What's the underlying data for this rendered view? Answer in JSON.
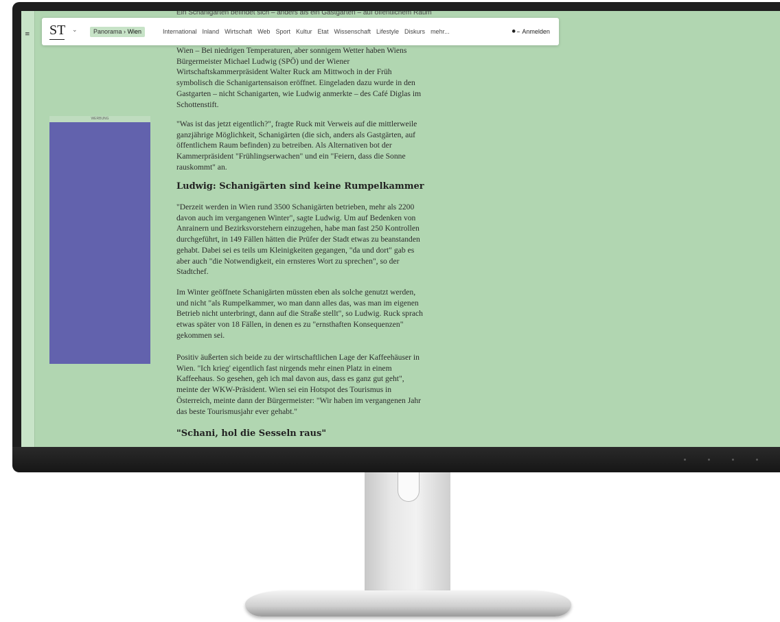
{
  "site": {
    "logo": "ST",
    "breadcrumb_section": "Panorama",
    "breadcrumb_sep": "›",
    "breadcrumb_current": "Wien",
    "nav_items": [
      "International",
      "Inland",
      "Wirtschaft",
      "Web",
      "Sport",
      "Kultur",
      "Etat",
      "Wissenschaft",
      "Lifestyle",
      "Diskurs",
      "mehr..."
    ],
    "login_label": "Anmelden"
  },
  "ad": {
    "label": "WERBUNG"
  },
  "article": {
    "teaser_cut": "Ein Schanigarten befindet sich – anders als ein Gastgarten – auf öffentlichem Raum",
    "p1": "Wien – Bei niedrigen Temperaturen, aber sonnigem Wetter haben Wiens Bürgermeister Michael Ludwig (SPÖ) und der Wiener Wirtschaftskammerpräsident Walter Ruck am Mittwoch in der Früh symbolisch die Schanigartensaison eröffnet. Eingeladen dazu wurde in den Gastgarten – nicht Schanigarten, wie Ludwig anmerkte – des Café Diglas im Schottenstift.",
    "p2": "\"Was ist das jetzt eigentlich?\", fragte Ruck mit Verweis auf die mittlerweile ganzjährige Möglichkeit, Schanigärten (die sich, anders als Gastgärten, auf öffentlichem Raum befinden) zu betreiben. Als Alternativen bot der Kammerpräsident \"Frühlingserwachen\" und ein \"Feiern, dass die Sonne rauskommt\" an.",
    "h1": "Ludwig: Schanigärten sind keine Rumpelkammer",
    "p3": "\"Derzeit werden in Wien rund 3500 Schanigärten betrieben, mehr als 2200 davon auch im vergangenen Winter\", sagte Ludwig. Um auf Bedenken von Anrainern und Bezirksvorstehern einzugehen, habe man fast 250 Kontrollen durchgeführt, in 149 Fällen hätten die Prüfer der Stadt etwas zu beanstanden gehabt. Dabei sei es teils um Kleinigkeiten gegangen, \"da und dort\" gab es aber auch \"die Notwendigkeit, ein ernsteres Wort zu sprechen\", so der Stadtchef.",
    "p4": "Im Winter geöffnete Schanigärten müssten eben als solche genutzt werden, und nicht \"als Rumpelkammer, wo man dann alles das, was man im eigenen Betrieb nicht unterbringt, dann auf die Straße stellt\", so Ludwig. Ruck sprach etwas später von 18 Fällen, in denen es zu \"ernsthaften Konsequenzen\" gekommen sei.",
    "p5": "Positiv äußerten sich beide zu der wirtschaftlichen Lage der Kaffeehäuser in Wien. \"Ich krieg' eigentlich fast nirgends mehr einen Platz in einem Kaffeehaus. So gesehen, geh ich mal davon aus, dass es ganz gut geht\", meinte der WKW-Präsident. Wien sei ein Hotspot des Tourismus in Österreich, meinte dann der Bürgermeister: \"Wir haben im vergangenen Jahr das beste Tourismusjahr ever gehabt.\"",
    "h2": "\"Schani, hol die Sesseln raus\""
  },
  "colors": {
    "page_background": "#b1d6b1",
    "ad_block": "#6262ad",
    "breadcrumb_chip": "#c7e3c7"
  },
  "icons": [
    "reader-mode-icon",
    "chevron-down-icon",
    "key-icon"
  ]
}
